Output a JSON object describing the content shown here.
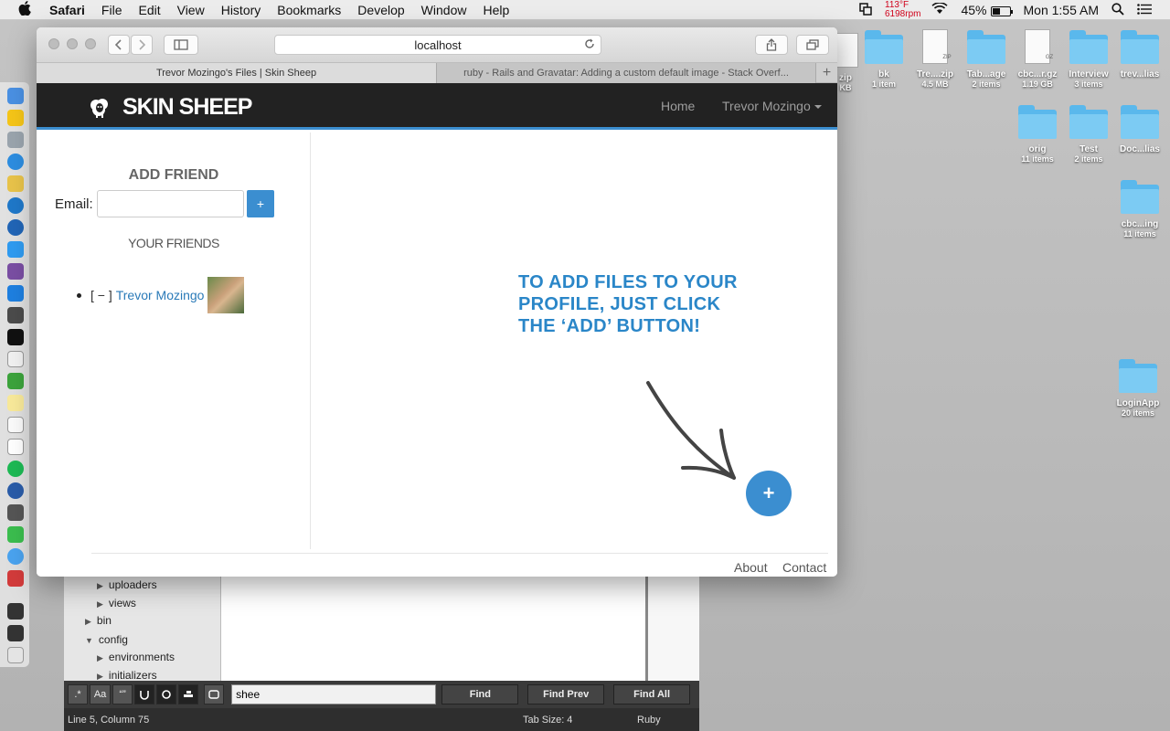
{
  "menubar": {
    "apple": "",
    "items": [
      "Safari",
      "File",
      "Edit",
      "View",
      "History",
      "Bookmarks",
      "Develop",
      "Window",
      "Help"
    ],
    "temp": "113°F",
    "rpm": "6198rpm",
    "battery": "45%",
    "clock": "Mon 1:55 AM"
  },
  "desktop_icons": [
    {
      "name": "zip",
      "sub": "KB"
    },
    {
      "name": "bk",
      "sub": "1 item"
    },
    {
      "name": "Tre....zip",
      "sub": "4.5 MB",
      "badge": "ZIP"
    },
    {
      "name": "Tab...age",
      "sub": "2 items"
    },
    {
      "name": "cbc...r.gz",
      "sub": "1.19 GB",
      "badge": "GZ"
    },
    {
      "name": "Interview",
      "sub": "3 items"
    },
    {
      "name": "trev...lias",
      "sub": ""
    },
    {
      "name": "orig",
      "sub": "11 items"
    },
    {
      "name": "Test",
      "sub": "2 items"
    },
    {
      "name": "Doc...lias",
      "sub": ""
    },
    {
      "name": "cbc...ing",
      "sub": "11 items"
    },
    {
      "name": "LoginApp",
      "sub": "20 items"
    }
  ],
  "safari": {
    "url": "localhost",
    "tabs": [
      "Trevor Mozingo's Files | Skin Sheep",
      "ruby - Rails and Gravatar: Adding a custom default image - Stack Overf..."
    ]
  },
  "site": {
    "brand": "SKIN SHEEP",
    "nav_home": "Home",
    "nav_user": "Trevor Mozingo",
    "add_friend_title": "ADD FRIEND",
    "email_label": "Email:",
    "add_button": "+",
    "your_friends": "YOUR FRIENDS",
    "friend_remove": "[ − ]",
    "friend_name": "Trevor Mozingo",
    "hint": "TO ADD FILES TO YOUR PROFILE, JUST CLICK THE ‘ADD’ BUTTON!",
    "fab": "+",
    "footer_about": "About",
    "footer_contact": "Contact"
  },
  "editor": {
    "tree": [
      {
        "label": "uploaders",
        "depth": 1,
        "open": false
      },
      {
        "label": "views",
        "depth": 1,
        "open": false
      },
      {
        "label": "bin",
        "depth": 0,
        "open": false
      },
      {
        "label": "config",
        "depth": 0,
        "open": true
      },
      {
        "label": "environments",
        "depth": 1,
        "open": false
      },
      {
        "label": "initializers",
        "depth": 1,
        "open": false
      }
    ],
    "find_value": "shee",
    "find_btn": "Find",
    "find_prev_btn": "Find Prev",
    "find_all_btn": "Find All",
    "status_position": "Line 5, Column 75",
    "status_tab": "Tab Size: 4",
    "status_syntax": "Ruby"
  },
  "colors": {
    "accent": "#3b8ed0",
    "navbar": "#222222",
    "hint": "#2a86c8"
  }
}
